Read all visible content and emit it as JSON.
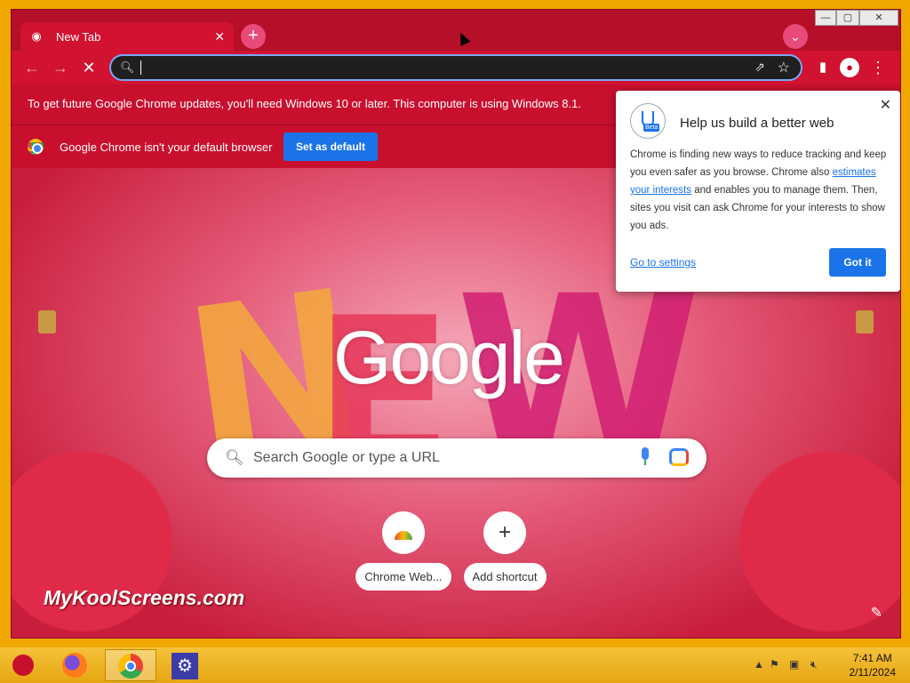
{
  "browser": {
    "tab_title": "New Tab",
    "tab_close": "✕",
    "new_tab_symbol": "+",
    "tab_search_symbol": "⌄",
    "window_controls": {
      "minimize": "—",
      "maximize": "▢",
      "close": "✕"
    }
  },
  "toolbar": {
    "back": "←",
    "forward": "→",
    "stop": "✕",
    "omnibox_value": "",
    "share_symbol": "⇗",
    "star_symbol": "☆",
    "sidepanel_symbol": "▮",
    "profile_symbol": "●",
    "menu_symbol": "⋮"
  },
  "infobars": {
    "update_text": "To get future Google Chrome updates, you'll need Windows 10 or later. This computer is using Windows 8.1.",
    "default_text": "Google Chrome isn't your default browser",
    "set_default_label": "Set as default"
  },
  "ntp": {
    "logo": "Google",
    "search_placeholder": "Search Google or type a URL",
    "shortcuts": [
      {
        "label": "Chrome Web..."
      },
      {
        "label": "Add shortcut",
        "symbol": "+"
      }
    ],
    "watermark": "MyKoolScreens.com",
    "customize_symbol": "✎"
  },
  "popup": {
    "title": "Help us build a better web",
    "beta_tag": "Beta",
    "close_symbol": "✕",
    "body_part1": "Chrome is finding new ways to reduce tracking and keep you even safer as you browse. Chrome also ",
    "body_link": "estimates your interests",
    "body_part2": " and enables you to manage them. Then, sites you visit can ask Chrome for your interests to show you ads.",
    "settings_link": "Go to settings",
    "got_it": "Got it"
  },
  "taskbar": {
    "time": "7:41 AM",
    "date": "2/11/2024",
    "settings_symbol": "⚙"
  },
  "colors": {
    "accent": "#1a73e8",
    "theme_red": "#c8102e",
    "taskbar": "#e6a612"
  }
}
